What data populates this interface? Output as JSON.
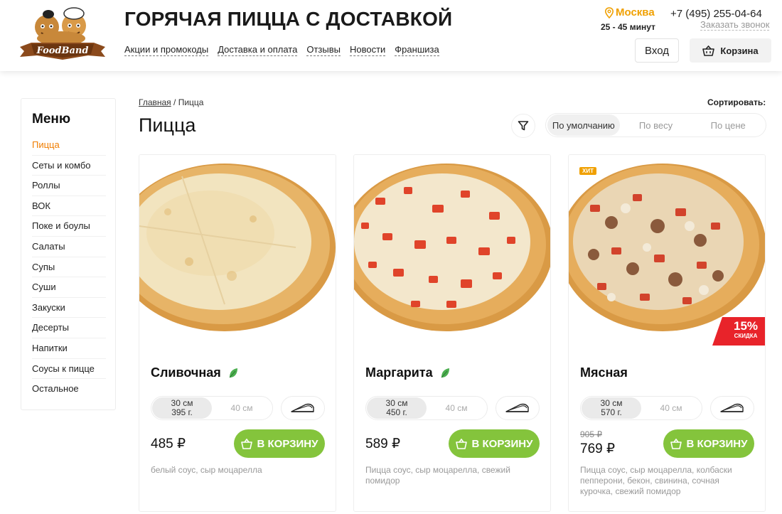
{
  "header": {
    "logo_text": "FoodBand",
    "site_title": "ГОРЯЧАЯ ПИЦЦА С ДОСТАВКОЙ",
    "nav": [
      "Акции и промокоды",
      "Доставка и оплата",
      "Отзывы",
      "Новости",
      "Франшиза"
    ],
    "city": "Москва",
    "delivery_time": "25 - 45 минут",
    "phone": "+7 (495) 255-04-64",
    "callback": "Заказать звонок",
    "login": "Вход",
    "cart": "Корзина"
  },
  "sidebar": {
    "title": "Меню",
    "items": [
      {
        "label": "Пицца"
      },
      {
        "label": "Сеты и комбо"
      },
      {
        "label": "Роллы"
      },
      {
        "label": "ВОК"
      },
      {
        "label": "Поке и боулы"
      },
      {
        "label": "Салаты"
      },
      {
        "label": "Супы"
      },
      {
        "label": "Суши"
      },
      {
        "label": "Закуски"
      },
      {
        "label": "Десерты"
      },
      {
        "label": "Напитки"
      },
      {
        "label": "Соусы к пицце"
      },
      {
        "label": "Остальное"
      }
    ]
  },
  "breadcrumb": {
    "home": "Главная",
    "separator": "/",
    "current": "Пицца"
  },
  "page_title": "Пицца",
  "sort": {
    "label": "Сортировать:",
    "options": [
      "По умолчанию",
      "По весу",
      "По цене"
    ],
    "selected": "По умолчанию"
  },
  "products": [
    {
      "name": "Сливочная",
      "vegetarian": true,
      "size_small": "30 см",
      "weight_small": "395 г.",
      "size_large": "40 см",
      "price": "485 ₽",
      "button": "В КОРЗИНУ",
      "description": "белый соус, сыр моцарелла"
    },
    {
      "name": "Маргарита",
      "vegetarian": true,
      "size_small": "30 см",
      "weight_small": "450 г.",
      "size_large": "40 см",
      "price": "589 ₽",
      "button": "В КОРЗИНУ",
      "description": "Пицца соус, сыр моцарелла, свежий помидор"
    },
    {
      "name": "Мясная",
      "vegetarian": false,
      "badge": "ХИТ",
      "discount": "15%",
      "discount_label": "СКИДКА",
      "size_small": "30 см",
      "weight_small": "570 г.",
      "size_large": "40 см",
      "old_price": "905 ₽",
      "price": "769 ₽",
      "button": "В КОРЗИНУ",
      "description": "Пицца соус, сыр моцарелла, колбаски пепперони, бекон, свинина, сочная курочка, свежий помидор"
    }
  ],
  "colors": {
    "accent_orange": "#f07d00",
    "city_yellow": "#f0a000",
    "cart_button_green": "#84c43c",
    "discount_red": "#e8232a",
    "veg_leaf_green": "#4caf50"
  },
  "icons": [
    "location-pin-icon",
    "basket-icon",
    "filter-icon",
    "leaf-icon",
    "crust-icon",
    "cart-add-icon"
  ]
}
